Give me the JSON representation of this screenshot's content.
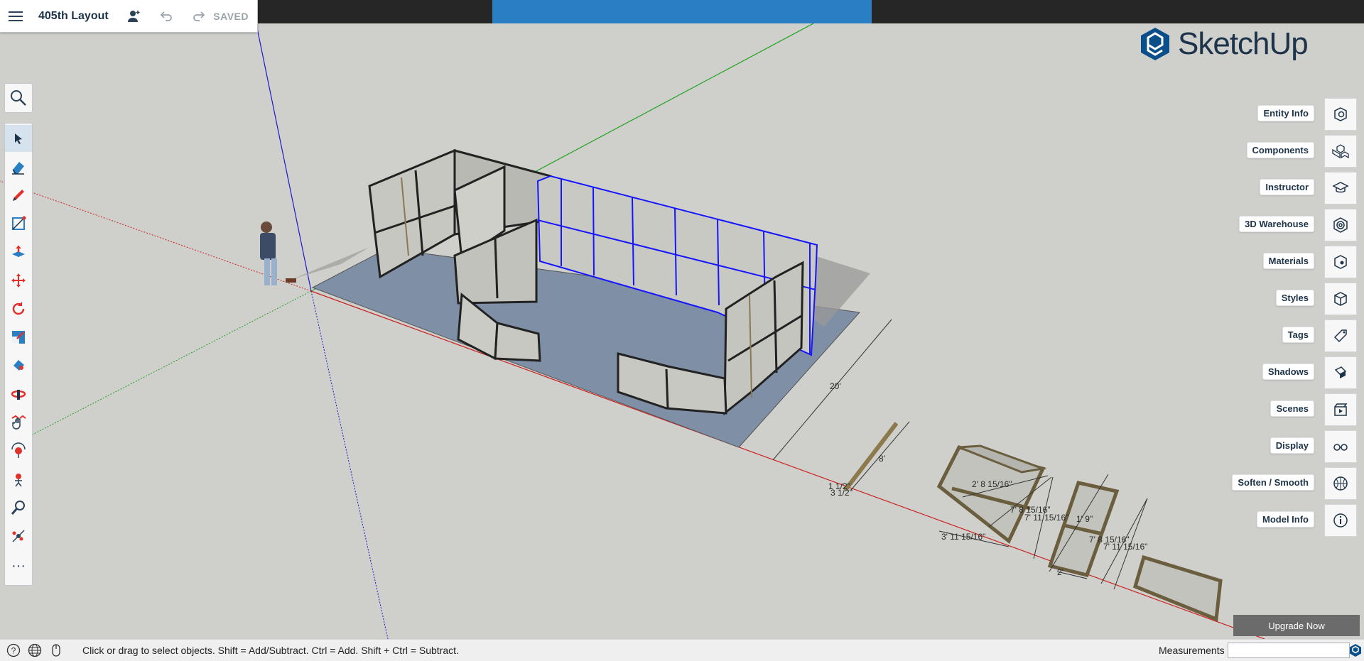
{
  "file": {
    "name": "405th Layout",
    "status": "SAVED"
  },
  "brand": {
    "logo_text": "SketchUp",
    "accent": "#0b4f8a"
  },
  "tools": [
    {
      "name": "select-tool",
      "icon": "arrow-cursor-icon"
    },
    {
      "name": "eraser-tool",
      "icon": "eraser-icon"
    },
    {
      "name": "pencil-tool",
      "icon": "pencil-icon"
    },
    {
      "name": "rectangle-tool",
      "icon": "rectangle-icon"
    },
    {
      "name": "push-pull-tool",
      "icon": "push-pull-icon"
    },
    {
      "name": "move-tool",
      "icon": "move-icon"
    },
    {
      "name": "rotate-tool",
      "icon": "rotate-icon"
    },
    {
      "name": "scale-tool",
      "icon": "scale-icon"
    },
    {
      "name": "paint-bucket-tool",
      "icon": "paint-icon"
    },
    {
      "name": "orbit-tool",
      "icon": "orbit-icon"
    },
    {
      "name": "pan-tool",
      "icon": "pan-hand-icon"
    },
    {
      "name": "position-camera-tool",
      "icon": "position-camera-icon"
    },
    {
      "name": "walk-tool",
      "icon": "walk-icon"
    },
    {
      "name": "zoom-tool",
      "icon": "magnifier-icon"
    },
    {
      "name": "zoom-extents-tool",
      "icon": "zoom-extents-icon"
    }
  ],
  "panels": [
    {
      "label": "Entity Info",
      "icon": "entity-info-icon"
    },
    {
      "label": "Components",
      "icon": "components-icon"
    },
    {
      "label": "Instructor",
      "icon": "mortarboard-icon"
    },
    {
      "label": "3D Warehouse",
      "icon": "warehouse-icon"
    },
    {
      "label": "Materials",
      "icon": "materials-icon"
    },
    {
      "label": "Styles",
      "icon": "styles-icon"
    },
    {
      "label": "Tags",
      "icon": "tag-icon"
    },
    {
      "label": "Shadows",
      "icon": "shadows-icon"
    },
    {
      "label": "Scenes",
      "icon": "scenes-icon"
    },
    {
      "label": "Display",
      "icon": "glasses-icon"
    },
    {
      "label": "Soften / Smooth",
      "icon": "soften-icon"
    },
    {
      "label": "Model Info",
      "icon": "info-icon"
    }
  ],
  "upgrade_label": "Upgrade Now",
  "status": {
    "hint": "Click or drag to select objects. Shift = Add/Subtract. Ctrl = Add. Shift + Ctrl = Subtract.",
    "measurements_label": "Measurements",
    "measurements_value": ""
  },
  "dimensions": {
    "d20": "20'",
    "d8": "8'",
    "d1_half": "1 1/2\"",
    "d3_half": "3 1/2\"",
    "d2_8": "2' 8 15/16\"",
    "d7_8a": "7' 8 15/16\"",
    "d7_11a": "7' 11 15/16\"",
    "d1_9": "1' 9\"",
    "d3_11": "3' 11 15/16\"",
    "d2": "2'",
    "d7_8b": "7' 8 15/16\"",
    "d7_11b": "7' 11 15/16\""
  }
}
